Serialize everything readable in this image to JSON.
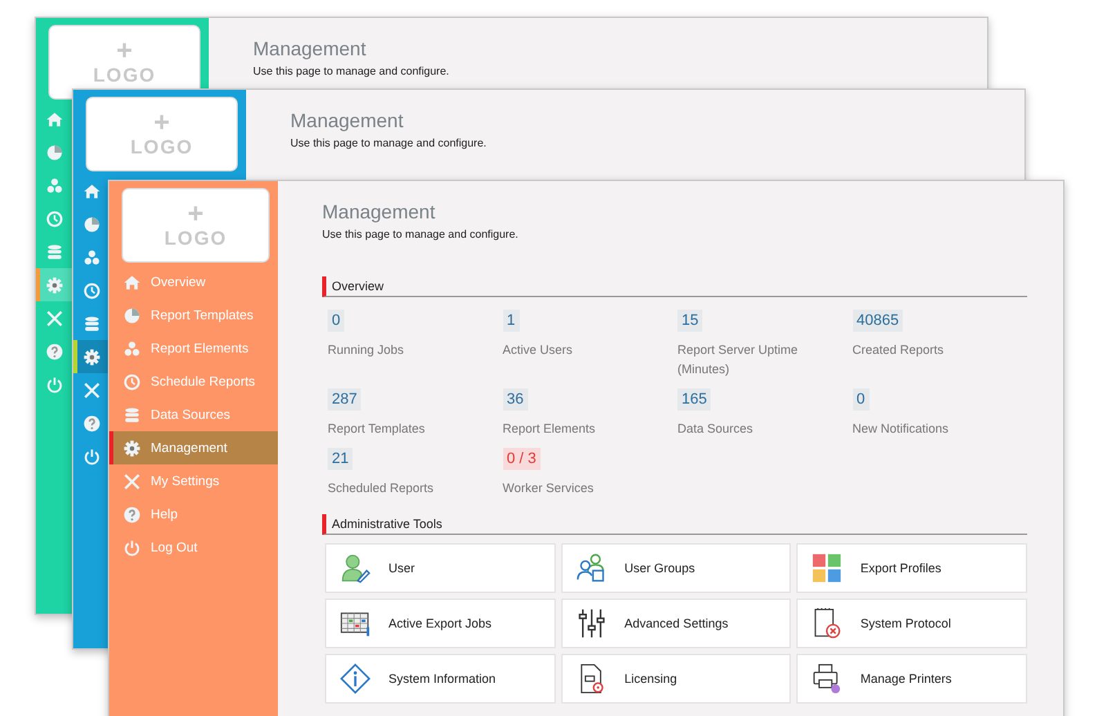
{
  "windows": [
    {
      "kind": "green",
      "color": "#1ed3a4",
      "logo": {
        "plus": "+",
        "text": "LOGO"
      },
      "title": "Management",
      "subtitle": "Use this page to manage and configure.",
      "menu": [
        {
          "kind": "home",
          "selected": false
        },
        {
          "kind": "pie",
          "selected": false
        },
        {
          "kind": "elements",
          "selected": false
        },
        {
          "kind": "clock",
          "selected": false
        },
        {
          "kind": "database",
          "selected": false
        },
        {
          "kind": "gear",
          "selected": true
        },
        {
          "kind": "tools",
          "selected": false
        },
        {
          "kind": "help",
          "selected": false
        },
        {
          "kind": "power",
          "selected": false
        }
      ]
    },
    {
      "kind": "blue",
      "color": "#18a0d8",
      "logo": {
        "plus": "+",
        "text": "LOGO"
      },
      "title": "Management",
      "subtitle": "Use this page to manage and configure.",
      "menu": [
        {
          "kind": "home",
          "selected": false
        },
        {
          "kind": "pie",
          "selected": false
        },
        {
          "kind": "elements",
          "selected": false
        },
        {
          "kind": "clock",
          "selected": false
        },
        {
          "kind": "database",
          "selected": false
        },
        {
          "kind": "gear",
          "selected": true
        },
        {
          "kind": "tools",
          "selected": false
        },
        {
          "kind": "help",
          "selected": false
        },
        {
          "kind": "power",
          "selected": false
        }
      ]
    },
    {
      "kind": "orange",
      "color": "#fd9567",
      "logo": {
        "plus": "+",
        "text": "LOGO"
      },
      "title": "Management",
      "subtitle": "Use this page to manage and configure.",
      "menu": [
        {
          "kind": "home",
          "label": "Overview",
          "selected": false
        },
        {
          "kind": "pie",
          "label": "Report Templates",
          "selected": false
        },
        {
          "kind": "elements",
          "label": "Report Elements",
          "selected": false
        },
        {
          "kind": "clock",
          "label": "Schedule Reports",
          "selected": false
        },
        {
          "kind": "database",
          "label": "Data Sources",
          "selected": false
        },
        {
          "kind": "gear",
          "label": "Management",
          "selected": true
        },
        {
          "kind": "tools",
          "label": "My Settings",
          "selected": false
        },
        {
          "kind": "help",
          "label": "Help",
          "selected": false
        },
        {
          "kind": "power",
          "label": "Log Out",
          "selected": false
        }
      ],
      "overview": {
        "heading": "Overview",
        "stats": [
          {
            "value": "0",
            "label": "Running Jobs",
            "alert": false
          },
          {
            "value": "1",
            "label": "Active Users",
            "alert": false
          },
          {
            "value": "15",
            "label": "Report Server Uptime (Minutes)",
            "alert": false
          },
          {
            "value": "40865",
            "label": "Created Reports",
            "alert": false
          },
          {
            "value": "287",
            "label": "Report Templates",
            "alert": false
          },
          {
            "value": "36",
            "label": "Report Elements",
            "alert": false
          },
          {
            "value": "165",
            "label": "Data Sources",
            "alert": false
          },
          {
            "value": "0",
            "label": "New Notifications",
            "alert": false
          },
          {
            "value": "21",
            "label": "Scheduled Reports",
            "alert": false
          },
          {
            "value": "0 / 3",
            "label": "Worker Services",
            "alert": true
          }
        ]
      },
      "tools": {
        "heading": "Administrative Tools",
        "items": [
          {
            "kind": "user",
            "label": "User"
          },
          {
            "kind": "user-groups",
            "label": "User Groups"
          },
          {
            "kind": "export-profiles",
            "label": "Export Profiles"
          },
          {
            "kind": "export-jobs",
            "label": "Active Export Jobs"
          },
          {
            "kind": "sliders",
            "label": "Advanced Settings"
          },
          {
            "kind": "protocol",
            "label": "System Protocol"
          },
          {
            "kind": "info",
            "label": "System Information"
          },
          {
            "kind": "licensing",
            "label": "Licensing"
          },
          {
            "kind": "printer",
            "label": "Manage Printers"
          }
        ]
      }
    }
  ]
}
